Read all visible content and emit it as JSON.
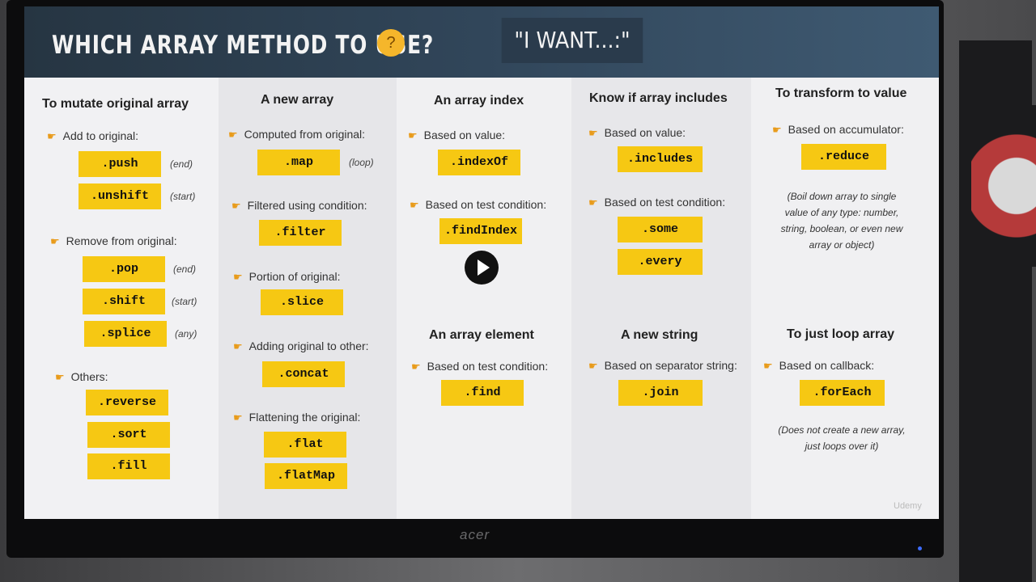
{
  "slide": {
    "title": "WHICH ARRAY METHOD TO USE?",
    "want": "\"I WANT...:\"",
    "watermark": "Udemy",
    "monitor_brand": "acer"
  },
  "columns": [
    {
      "heading": "To mutate original array",
      "groups": [
        {
          "label": "Add to original:",
          "methods": [
            ".push",
            ".unshift"
          ],
          "notes": [
            "(end)",
            "(start)"
          ]
        },
        {
          "label": "Remove from original:",
          "methods": [
            ".pop",
            ".shift",
            ".splice"
          ],
          "notes": [
            "(end)",
            "(start)",
            "(any)"
          ]
        },
        {
          "label": "Others:",
          "methods": [
            ".reverse",
            ".sort",
            ".fill"
          ]
        }
      ]
    },
    {
      "heading": "A new array",
      "groups": [
        {
          "label": "Computed from original:",
          "methods": [
            ".map"
          ],
          "notes": [
            "(loop)"
          ]
        },
        {
          "label": "Filtered using condition:",
          "methods": [
            ".filter"
          ]
        },
        {
          "label": "Portion of original:",
          "methods": [
            ".slice"
          ]
        },
        {
          "label": "Adding original to other:",
          "methods": [
            ".concat"
          ]
        },
        {
          "label": "Flattening the original:",
          "methods": [
            ".flat",
            ".flatMap"
          ]
        }
      ]
    },
    {
      "heading": "An array index",
      "groups": [
        {
          "label": "Based on value:",
          "methods": [
            ".indexOf"
          ]
        },
        {
          "label": "Based on test condition:",
          "methods": [
            ".findIndex"
          ]
        }
      ],
      "heading2": "An array element",
      "groups2": [
        {
          "label": "Based on test condition:",
          "methods": [
            ".find"
          ]
        }
      ]
    },
    {
      "heading": "Know if array includes",
      "groups": [
        {
          "label": "Based on value:",
          "methods": [
            ".includes"
          ]
        },
        {
          "label": "Based on test condition:",
          "methods": [
            ".some",
            ".every"
          ]
        }
      ],
      "heading2": "A new string",
      "groups2": [
        {
          "label": "Based on separator string:",
          "methods": [
            ".join"
          ]
        }
      ]
    },
    {
      "heading": "To transform to value",
      "groups": [
        {
          "label": "Based on accumulator:",
          "methods": [
            ".reduce"
          ]
        }
      ],
      "desc": [
        "(Boil down array to single",
        "value of any type: number,",
        "string, boolean, or even new",
        "array or object)"
      ],
      "heading2": "To just loop array",
      "groups2": [
        {
          "label": "Based on callback:",
          "methods": [
            ".forEach"
          ]
        }
      ],
      "desc2": [
        "(Does not create a new array,",
        "just loops over it)"
      ]
    }
  ],
  "colors": {
    "method_bg": "#f6c813",
    "header_bg": "#31465a",
    "hand": "#e89b1b"
  }
}
